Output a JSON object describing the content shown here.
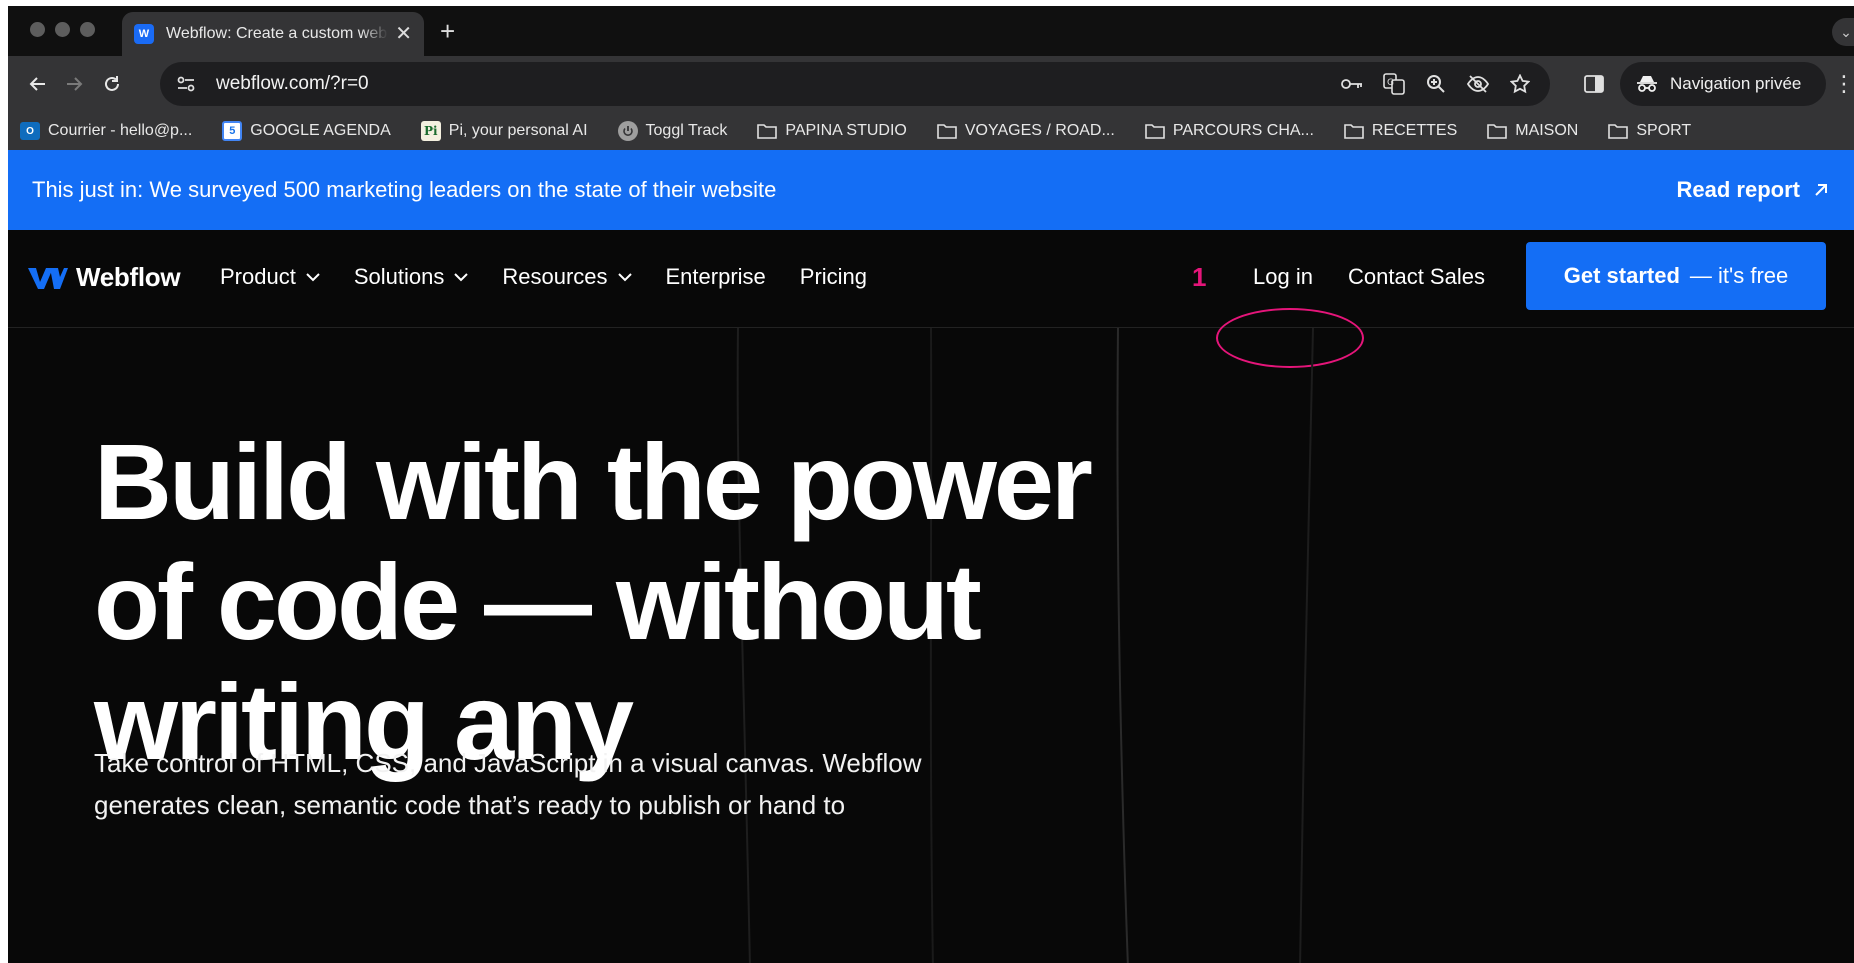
{
  "browser": {
    "tab": {
      "title": "Webflow: Create a custom website | Visual website builder",
      "favicon_text": "W"
    },
    "url": "webflow.com/?r=0",
    "profile_label": "Navigation privée",
    "bookmarks": [
      {
        "label": "Courrier - hello@p...",
        "icon": "outlook-icon"
      },
      {
        "label": "GOOGLE AGENDA",
        "icon": "google-calendar-icon"
      },
      {
        "label": "Pi, your personal AI",
        "icon": "pi-icon"
      },
      {
        "label": "Toggl Track",
        "icon": "toggl-icon"
      },
      {
        "label": "PAPINA STUDIO",
        "icon": "folder-icon"
      },
      {
        "label": "VOYAGES / ROAD...",
        "icon": "folder-icon"
      },
      {
        "label": "PARCOURS CHA...",
        "icon": "folder-icon"
      },
      {
        "label": "RECETTES",
        "icon": "folder-icon"
      },
      {
        "label": "MAISON",
        "icon": "folder-icon"
      },
      {
        "label": "SPORT",
        "icon": "folder-icon"
      }
    ]
  },
  "page": {
    "banner": {
      "text": "This just in: We surveyed 500 marketing leaders on the state of their website",
      "link": "Read report"
    },
    "nav": {
      "logo": "Webflow",
      "items": [
        {
          "label": "Product",
          "dropdown": true
        },
        {
          "label": "Solutions",
          "dropdown": true
        },
        {
          "label": "Resources",
          "dropdown": true
        },
        {
          "label": "Enterprise",
          "dropdown": false
        },
        {
          "label": "Pricing",
          "dropdown": false
        }
      ],
      "login": "Log in",
      "contact": "Contact Sales",
      "cta_bold": "Get started",
      "cta_rest": "— it's free"
    },
    "hero": {
      "title": "Build with the power of code — without writing any",
      "subtitle": "Take control of HTML, CSS, and JavaScript in a visual canvas. Webflow generates clean, semantic code that’s ready to publish or hand to"
    },
    "annotation": {
      "number": "1",
      "color": "#e5157a"
    }
  },
  "colors": {
    "brand_blue": "#146ef5",
    "background": "#080808"
  }
}
